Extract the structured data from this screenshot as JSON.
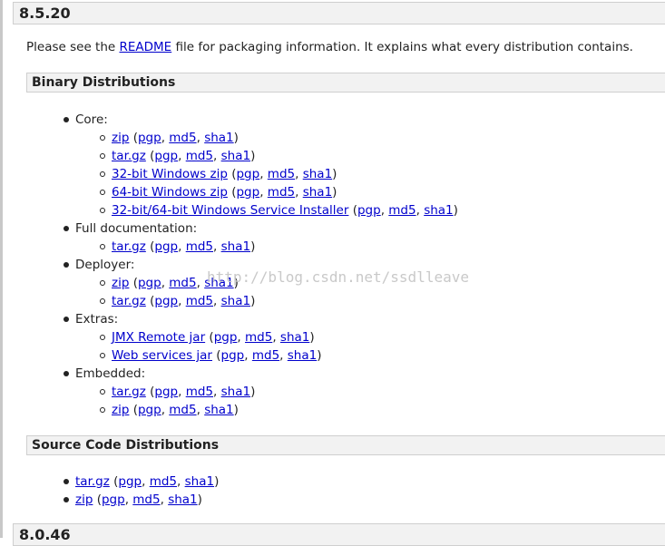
{
  "releases": {
    "current": "8.5.20",
    "next": "8.0.46"
  },
  "intro": {
    "before": "Please see the ",
    "link": "README",
    "after": " file for packaging information. It explains what every distribution contains."
  },
  "sections": {
    "binary": "Binary Distributions",
    "source": "Source Code Distributions"
  },
  "groups": {
    "core": "Core:",
    "fulldoc": "Full documentation:",
    "deployer": "Deployer:",
    "extras": "Extras:",
    "embedded": "Embedded:"
  },
  "links": {
    "zip": "zip",
    "targz": "tar.gz",
    "win32": "32-bit Windows zip",
    "win64": "64-bit Windows zip",
    "installer": "32-bit/64-bit Windows Service Installer",
    "jmx": "JMX Remote jar",
    "ws": "Web services jar",
    "pgp": "pgp",
    "md5": "md5",
    "sha1": "sha1"
  },
  "punct": {
    "open": " (",
    "comma": ", ",
    "close": ")"
  },
  "watermark": "http://blog.csdn.net/ssdlleave"
}
